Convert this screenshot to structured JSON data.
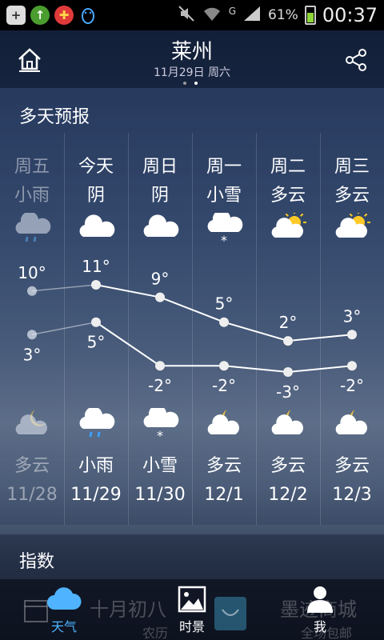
{
  "status_bar": {
    "battery_pct": "61%",
    "time": "00:37",
    "signal_label": "G"
  },
  "header": {
    "city": "莱州",
    "date": "11月29日 周六"
  },
  "forecast": {
    "title": "多天预报",
    "days": [
      {
        "name": "周五",
        "cond": "小雨",
        "icon": "rain-cloud-icon",
        "high": "10°",
        "low": "3°",
        "night_cond": "多云",
        "night_icon": "moon-cloud-icon",
        "date": "11/28",
        "past": true
      },
      {
        "name": "今天",
        "cond": "阴",
        "icon": "cloud-icon",
        "high": "11°",
        "low": "5°",
        "night_cond": "小雨",
        "night_icon": "rain-cloud-icon",
        "date": "11/29",
        "past": false
      },
      {
        "name": "周日",
        "cond": "阴",
        "icon": "cloud-icon",
        "high": "9°",
        "low": "-2°",
        "night_cond": "小雪",
        "night_icon": "snow-cloud-icon",
        "date": "11/30",
        "past": false
      },
      {
        "name": "周一",
        "cond": "小雪",
        "icon": "snow-cloud-icon",
        "high": "5°",
        "low": "-2°",
        "night_cond": "多云",
        "night_icon": "moon-cloud-icon",
        "date": "12/1",
        "past": false
      },
      {
        "name": "周二",
        "cond": "多云",
        "icon": "sun-cloud-icon",
        "high": "2°",
        "low": "-3°",
        "night_cond": "多云",
        "night_icon": "moon-cloud-icon",
        "date": "12/2",
        "past": false
      },
      {
        "name": "周三",
        "cond": "多云",
        "icon": "sun-cloud-icon",
        "high": "3°",
        "low": "-2°",
        "night_cond": "多云",
        "night_icon": "moon-cloud-icon",
        "date": "12/3",
        "past": false
      }
    ]
  },
  "chart_data": {
    "type": "line",
    "categories": [
      "11/28",
      "11/29",
      "11/30",
      "12/1",
      "12/2",
      "12/3"
    ],
    "series": [
      {
        "values": [
          10,
          11,
          9,
          5,
          2,
          3
        ]
      },
      {
        "values": [
          3,
          5,
          -2,
          -2,
          -3,
          -2
        ]
      }
    ],
    "ylim": [
      -4,
      12
    ]
  },
  "index_section": {
    "title": "指数"
  },
  "tabbar": {
    "tabs": [
      {
        "label": "天气",
        "icon": "cloud-icon",
        "active": true
      },
      {
        "label": "时景",
        "icon": "picture-icon",
        "active": false
      },
      {
        "label": "我",
        "icon": "person-icon",
        "active": false
      }
    ],
    "bg_text_left": "十月初八",
    "bg_text_left_small": "农历",
    "bg_text_right": "墨迹商城",
    "bg_text_right_small": "全场包邮"
  },
  "colors": {
    "accent": "#4fb3ff",
    "line": "#ffffff"
  }
}
